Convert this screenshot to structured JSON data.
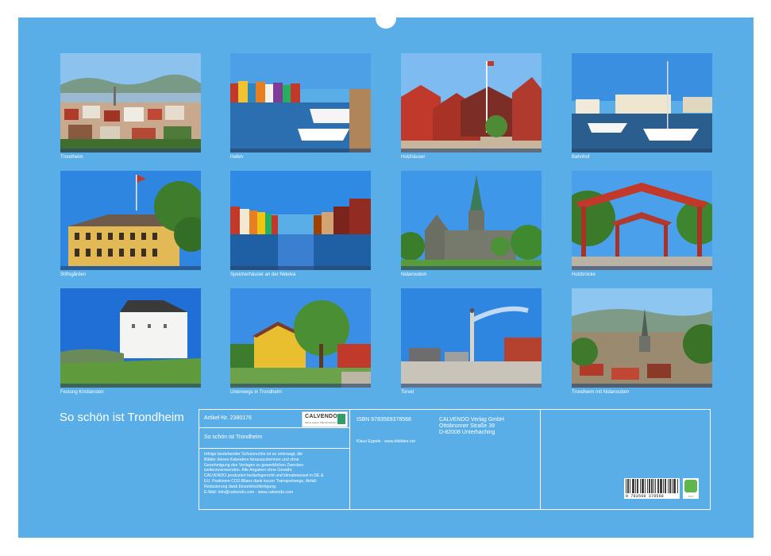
{
  "photos": [
    {
      "caption": "Trondheim"
    },
    {
      "caption": "Hafen"
    },
    {
      "caption": "Holzhäuser"
    },
    {
      "caption": "Bahnhof"
    },
    {
      "caption": "Stiftsgården"
    },
    {
      "caption": "Speicherhäuser an der Nidelva"
    },
    {
      "caption": "Nidarosdom"
    },
    {
      "caption": "Holzbrücke"
    },
    {
      "caption": "Festung Kristiansten"
    },
    {
      "caption": "Unterwegs in Trondheim"
    },
    {
      "caption": "Torvet"
    },
    {
      "caption": "Trondheim mit Nidarosdom"
    }
  ],
  "cover": {
    "title": "So schön ist Trondheim"
  },
  "info": {
    "article_label": "Artikel-Nr. 2380176",
    "title": "So schön ist Trondheim",
    "isbn": "ISBN 9783569378568",
    "publisher": "CALVENDO Verlag GmbH",
    "street": "Ottobrunner Straße 39",
    "city": "D-82008 Unterhaching",
    "author": "Klaus Eppele · www.bildidee.net",
    "legal": [
      "Infolge bestehender Schutzrechte ist es untersagt, die",
      "Blätter dieses Kalenders herauszutrennen und ohne",
      "Genehmigung des Verlages zu gewerblichen Zwecken",
      "weiterzuverwenden. Alle Angaben ohne Gewähr.",
      "CALVENDO produziert bedarfsgerecht und klimabewusst in DE &",
      "EU. Positivere CO2-Bilanz dank kurzer Transportwege, Abfall-",
      "Reduzierung dank Einzelstückfertigung.",
      "E-Mail: info@calvendo.com · www.calvendo.com"
    ],
    "logo_text": "CALVENDO",
    "logo_sub": "Meine eigene Kalenderedition",
    "barcode_number": "9 783569 378568",
    "eco_label": "eco"
  },
  "colors": {
    "background": "#5aaee8",
    "sheet_edge": "#ffffff"
  }
}
